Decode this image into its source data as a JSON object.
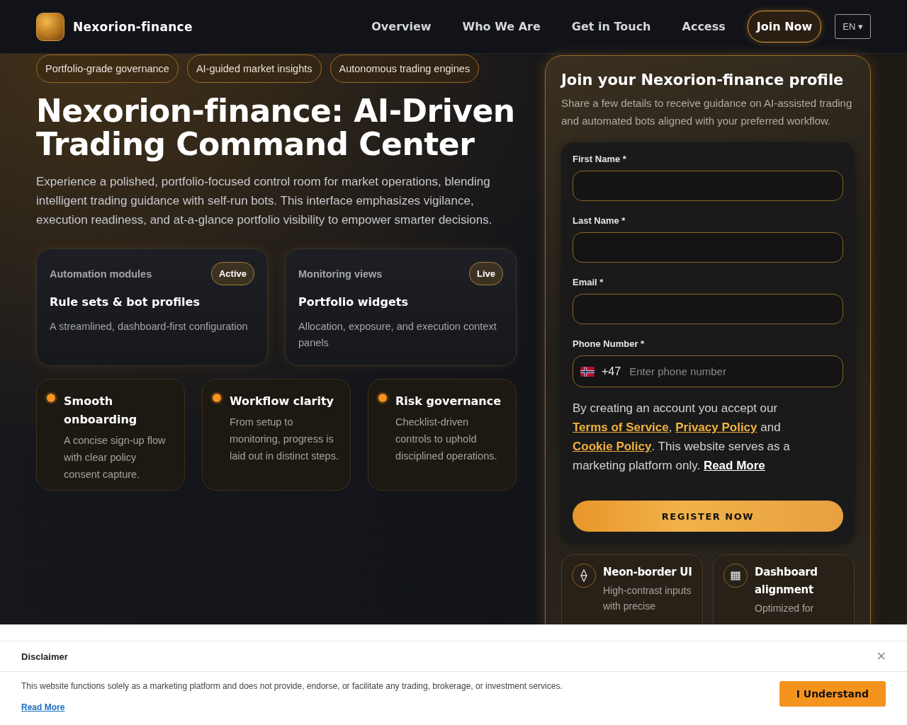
{
  "header": {
    "brand": "Nexorion-finance",
    "nav": [
      {
        "label": "Overview"
      },
      {
        "label": "Who We Are"
      },
      {
        "label": "Get in Touch"
      },
      {
        "label": "Access"
      }
    ],
    "cta": "Join Now",
    "language": "EN ▾"
  },
  "hero": {
    "chips": [
      "Portfolio-grade governance",
      "AI-guided market insights",
      "Autonomous trading engines"
    ],
    "title": "Nexorion-finance: AI-Driven Trading Command Center",
    "lead": "Experience a polished, portfolio-focused control room for market operations, blending intelligent trading guidance with self-run bots. This interface emphasizes vigilance, execution readiness, and at-a-glance portfolio visibility to empower smarter decisions.",
    "panels": [
      {
        "eyebrow": "Automation modules",
        "badge": "Active",
        "title": "Rule sets & bot profiles",
        "text": "A streamlined, dashboard-first configuration"
      },
      {
        "eyebrow": "Monitoring views",
        "badge": "Live",
        "title": "Portfolio widgets",
        "text": "Allocation, exposure, and execution context panels"
      }
    ],
    "features": [
      {
        "title": "Smooth onboarding",
        "text": "A concise sign-up flow with clear policy consent capture.",
        "color": "#f7931e"
      },
      {
        "title": "Workflow clarity",
        "text": "From setup to monitoring, progress is laid out in distinct steps.",
        "color": "#f7931e"
      },
      {
        "title": "Risk governance",
        "text": "Checklist-driven controls to uphold disciplined operations.",
        "color": "#f7931e"
      }
    ]
  },
  "signup": {
    "title": "Join your Nexorion-finance profile",
    "subtitle": "Share a few details to receive guidance on AI-assisted trading and automated bots aligned with your preferred workflow.",
    "fields": [
      {
        "label": "First Name *"
      },
      {
        "label": "Last Name *"
      },
      {
        "label": "Email *"
      }
    ],
    "phone": {
      "label": "Phone Number *",
      "code": "+47",
      "placeholder": "Enter phone number"
    },
    "legal": [
      {
        "kind": "text",
        "text": "By creating an account you accept our "
      },
      {
        "kind": "link",
        "text": "Terms of Service"
      },
      {
        "kind": "text",
        "text": ", "
      },
      {
        "kind": "link",
        "text": "Privacy Policy"
      },
      {
        "kind": "text",
        "text": " and "
      },
      {
        "kind": "link",
        "text": "Cookie Policy"
      },
      {
        "kind": "text",
        "text": ". This website serves as a marketing platform only. "
      },
      {
        "kind": "more",
        "text": "Read More"
      }
    ],
    "submit": "REGISTER NOW",
    "highlights": [
      {
        "kind": "diamond",
        "title": "Neon-border UI",
        "text": "High-contrast inputs with precise"
      },
      {
        "kind": "grid",
        "title": "Dashboard alignment",
        "text": "Optimized for"
      }
    ]
  },
  "disclaimer": {
    "title": "Disclaimer",
    "close": "×",
    "text": "This website functions solely as a marketing platform and does not provide, endorse, or facilitate any trading, brokerage, or investment services.",
    "link": "Read More",
    "button": "I Understand"
  }
}
